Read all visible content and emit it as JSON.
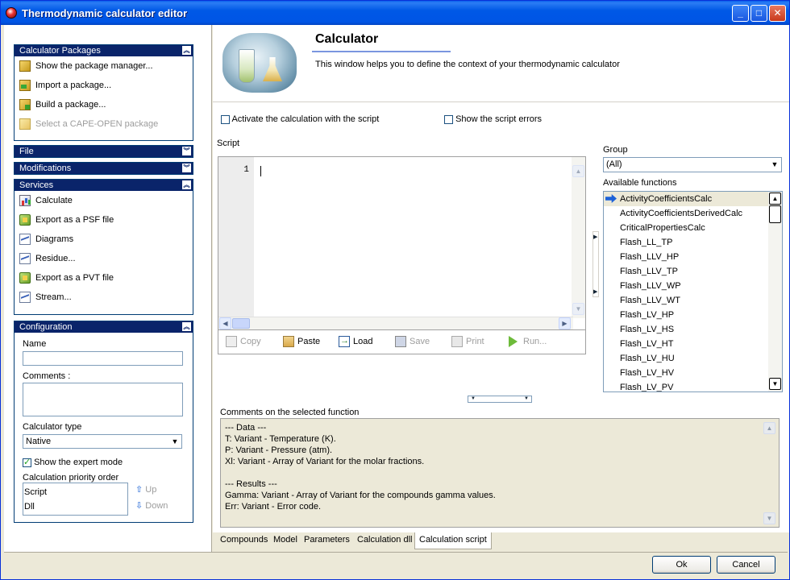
{
  "window": {
    "title": "Thermodynamic calculator editor"
  },
  "titlebar_buttons": {
    "minimize": "_",
    "maximize": "□",
    "close": "✕"
  },
  "sidebar": {
    "packages": {
      "title": "Calculator Packages",
      "items": [
        {
          "label": "Show the package manager...",
          "icon": "package-icon",
          "enabled": true
        },
        {
          "label": "Import a package...",
          "icon": "import-package-icon",
          "enabled": true
        },
        {
          "label": "Build a package...",
          "icon": "build-package-icon",
          "enabled": true
        },
        {
          "label": "Select a CAPE-OPEN package",
          "icon": "cape-open-icon",
          "enabled": false
        }
      ]
    },
    "file": {
      "title": "File"
    },
    "modifications": {
      "title": "Modifications"
    },
    "services": {
      "title": "Services",
      "items": [
        {
          "label": "Calculate",
          "icon": "calculate-icon"
        },
        {
          "label": "Export as a PSF file",
          "icon": "export-icon"
        },
        {
          "label": "Diagrams",
          "icon": "diagram-icon"
        },
        {
          "label": "Residue...",
          "icon": "diagram-icon"
        },
        {
          "label": "Export as a PVT file",
          "icon": "export-icon"
        },
        {
          "label": "Stream...",
          "icon": "diagram-icon"
        }
      ]
    },
    "configuration": {
      "title": "Configuration",
      "name_label": "Name",
      "name_value": "",
      "comments_label": "Comments :",
      "comments_value": "",
      "calc_type_label": "Calculator type",
      "calc_type_value": "Native",
      "expert_mode_label": "Show the expert mode",
      "expert_mode_checked": true,
      "priority_label": "Calculation priority order",
      "priority_items": [
        "Script",
        "Dll"
      ],
      "up_label": "Up",
      "down_label": "Down"
    }
  },
  "header": {
    "title": "Calculator",
    "description": "This window helps you to define the context of your thermodynamic calculator"
  },
  "options": {
    "activate_script": "Activate the calculation with the script",
    "show_errors": "Show the script errors"
  },
  "script": {
    "label": "Script",
    "line_number": "1",
    "content": ""
  },
  "toolbar": {
    "copy": "Copy",
    "paste": "Paste",
    "load": "Load",
    "save": "Save",
    "print": "Print",
    "run": "Run..."
  },
  "group": {
    "label": "Group",
    "value": "(All)"
  },
  "functions": {
    "label": "Available functions",
    "items": [
      "ActivityCoefficientsCalc",
      "ActivityCoefficientsDerivedCalc",
      "CriticalPropertiesCalc",
      "Flash_LL_TP",
      "Flash_LLV_HP",
      "Flash_LLV_TP",
      "Flash_LLV_WP",
      "Flash_LLV_WT",
      "Flash_LV_HP",
      "Flash_LV_HS",
      "Flash_LV_HT",
      "Flash_LV_HU",
      "Flash_LV_HV",
      "Flash_LV_PV"
    ],
    "selected_index": 0
  },
  "comments": {
    "label": "Comments on the selected function",
    "lines": [
      "--- Data ---",
      "T: Variant - Temperature (K).",
      "P: Variant - Pressure (atm).",
      "Xl: Variant - Array of Variant for the molar fractions.",
      "",
      "--- Results ---",
      "Gamma: Variant - Array of Variant for the compounds gamma values.",
      "Err: Variant - Error code."
    ]
  },
  "tabs": [
    "Compounds",
    "Model",
    "Parameters",
    "Calculation dll",
    "Calculation script"
  ],
  "active_tab": 4,
  "footer": {
    "ok": "Ok",
    "cancel": "Cancel"
  }
}
